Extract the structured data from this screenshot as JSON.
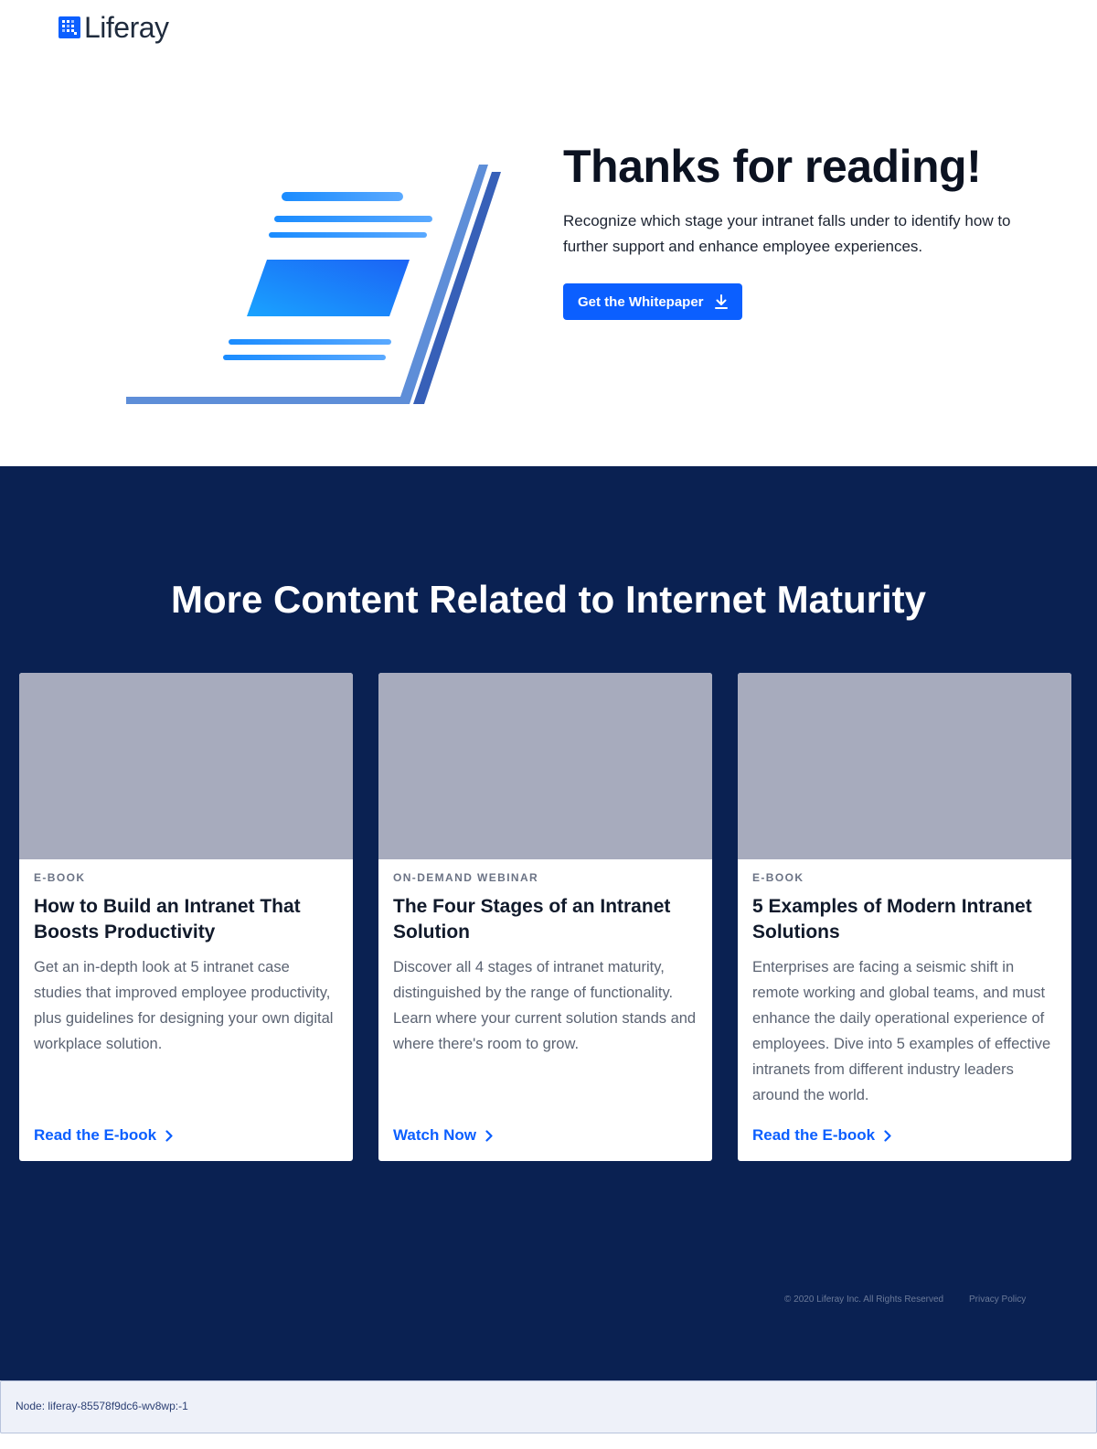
{
  "header": {
    "logo_text": "Liferay",
    "logo_icon": "liferay-logo-icon"
  },
  "hero": {
    "title": "Thanks for reading!",
    "description": "Recognize which stage your intranet falls under to identify how to further support and enhance employee experiences.",
    "cta_label": "Get the Whitepaper",
    "cta_icon": "download-icon",
    "illustration": "document-illustration"
  },
  "related": {
    "title": "More Content Related to Internet Maturity",
    "cards": [
      {
        "kicker": "E-BOOK",
        "title": "How to Build an Intranet That Boosts Productivity",
        "description": "Get an in-depth look at 5 intranet case studies that improved employee productivity, plus guidelines for designing your own digital workplace solution.",
        "link": "Read the E-book"
      },
      {
        "kicker": "ON-DEMAND WEBINAR",
        "title": "The Four Stages of an Intranet Solution",
        "description": "Discover all 4 stages of intranet maturity, distinguished by the range of functionality. Learn where your current solution stands and where there's room to grow.",
        "link": "Watch Now"
      },
      {
        "kicker": "E-BOOK",
        "title": "5 Examples of Modern Intranet Solutions",
        "description": "Enterprises are facing a seismic shift in remote working and global teams, and must enhance the daily operational experience of employees. Dive into 5 examples of effective intranets from different industry leaders around the world.",
        "link": "Read the E-book"
      }
    ]
  },
  "footer": {
    "copyright": "© 2020 Liferay Inc. All Rights Reserved",
    "privacy": "Privacy Policy"
  },
  "node": {
    "text": "Node: liferay-85578f9dc6-wv8wp:-1"
  },
  "colors": {
    "brand_blue": "#0b5fff",
    "navy": "#0a2152",
    "card_image": "#a7abbd"
  }
}
